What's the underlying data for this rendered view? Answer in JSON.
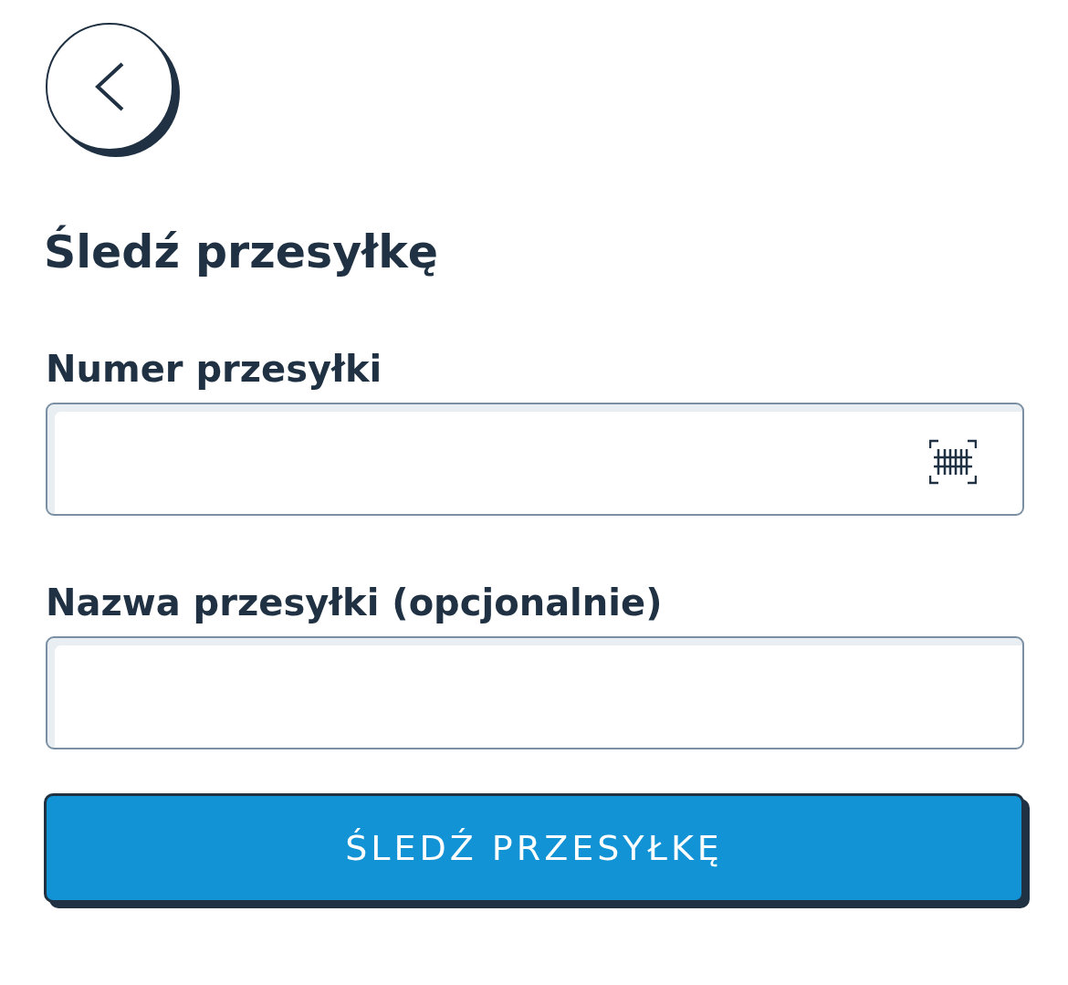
{
  "title": "Śledź przesyłkę",
  "fields": [
    {
      "label": "Numer przesyłki",
      "kind": "scan"
    },
    {
      "label": "Nazwa przesyłki (opcjonalnie)",
      "kind": "plain"
    }
  ],
  "submit_button": {
    "label": "ŚLEDŹ PRZESYŁKĘ"
  }
}
